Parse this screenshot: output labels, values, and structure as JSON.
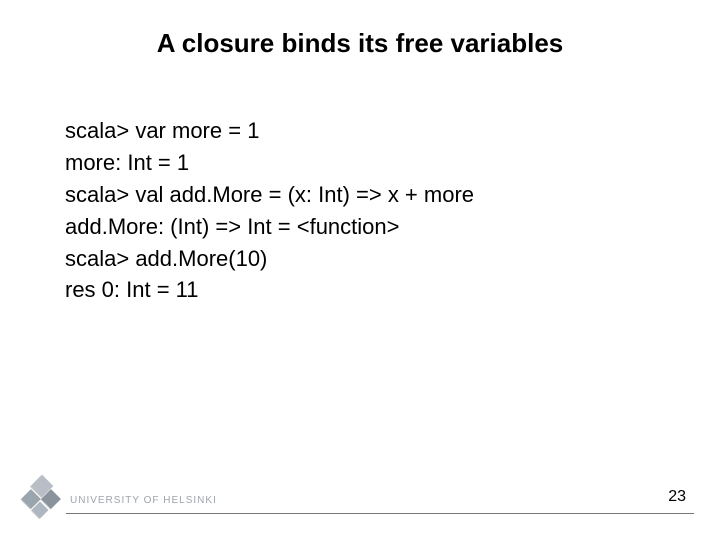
{
  "title": "A closure binds its free variables",
  "code": {
    "l1": "scala> var more = 1",
    "l2": "more: Int = 1",
    "l3": "scala> val add.More = (x: Int) => x + more",
    "l4": "add.More: (Int) => Int = <function>",
    "l5": "scala> add.More(10)",
    "l6": "res 0: Int = 11"
  },
  "footer": {
    "university": "UNIVERSITY OF HELSINKI",
    "page": "23"
  }
}
